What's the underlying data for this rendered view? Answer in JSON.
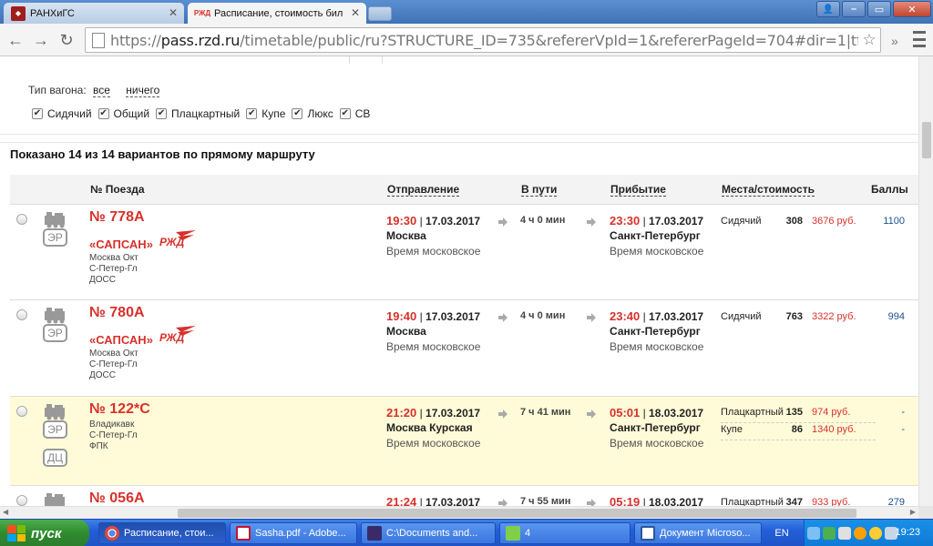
{
  "browser": {
    "tabs": [
      {
        "title": "РАНХиГС"
      },
      {
        "title": "Расписание, стоимость бил",
        "favicon_text": "РЖД"
      }
    ],
    "window_controls": {
      "user": "👤",
      "minimize": "–",
      "restore": "▭",
      "close": "✕"
    },
    "url": {
      "scheme": "https://",
      "host": "pass.rzd.ru",
      "path": "/timetable/public/ru?STRUCTURE_ID=735&refererVpId=1&refererPageId=704#dir=1|tfl=3|chec"
    },
    "menu_label": "≡",
    "ext_glyph": "»"
  },
  "filter": {
    "label": "Тип вагона:",
    "all_link": "все",
    "none_link": "ничего",
    "car_types": [
      "Сидячий",
      "Общий",
      "Плацкартный",
      "Купе",
      "Люкс",
      "СВ"
    ]
  },
  "results_summary": "Показано 14 из 14 вариантов по прямому маршруту",
  "table": {
    "headers": {
      "train": "№ Поезда",
      "departure": "Отправление",
      "duration": "В пути",
      "arrival": "Прибытие",
      "seats": "Места/стоимость",
      "points": "Баллы"
    },
    "rows": [
      {
        "train_number": "№ 778А",
        "brand": "«САПСАН»",
        "type_badges": [
          "ЭР"
        ],
        "route": [
          "Москва Окт",
          "С-Петер-Гл",
          "ДОСС"
        ],
        "dep_time": "19:30",
        "dep_date": "17.03.2017",
        "dep_station": "Москва",
        "dep_tz": "Время московское",
        "duration": "4 ч 0 мин",
        "arr_time": "23:30",
        "arr_date": "17.03.2017",
        "arr_station": "Санкт-Петербург",
        "arr_tz": "Время московское",
        "seats": [
          {
            "class": "Сидячий",
            "count": "308",
            "price": "3676 руб.",
            "points": "1100"
          }
        ]
      },
      {
        "train_number": "№ 780А",
        "brand": "«САПСАН»",
        "type_badges": [
          "ЭР"
        ],
        "route": [
          "Москва Окт",
          "С-Петер-Гл",
          "ДОСС"
        ],
        "dep_time": "19:40",
        "dep_date": "17.03.2017",
        "dep_station": "Москва",
        "dep_tz": "Время московское",
        "duration": "4 ч 0 мин",
        "arr_time": "23:40",
        "arr_date": "17.03.2017",
        "arr_station": "Санкт-Петербург",
        "arr_tz": "Время московское",
        "seats": [
          {
            "class": "Сидячий",
            "count": "763",
            "price": "3322 руб.",
            "points": "994"
          }
        ]
      },
      {
        "train_number": "№ 122*С",
        "brand": "",
        "type_badges": [
          "ЭР",
          "ДЦ"
        ],
        "route": [
          "Владикавк",
          "С-Петер-Гл",
          "ФПК"
        ],
        "dep_time": "21:20",
        "dep_date": "17.03.2017",
        "dep_station": "Москва Курская",
        "dep_tz": "Время московское",
        "duration": "7 ч 41 мин",
        "arr_time": "05:01",
        "arr_date": "18.03.2017",
        "arr_station": "Санкт-Петербург",
        "arr_tz": "Время московское",
        "seats": [
          {
            "class": "Плацкартный",
            "count": "135",
            "price": "974 руб.",
            "points": "-"
          },
          {
            "class": "Купе",
            "count": "86",
            "price": "1340 руб.",
            "points": "-"
          }
        ]
      },
      {
        "train_number": "№ 056А",
        "dep_time": "21:24",
        "dep_date": "17.03.2017",
        "duration": "7 ч 55 мин",
        "arr_time": "05:19",
        "arr_date": "18.03.2017",
        "seats": [
          {
            "class": "Плацкартный",
            "count": "347",
            "price": "933 руб.",
            "points": "279"
          }
        ]
      }
    ]
  },
  "taskbar": {
    "start_label": "пуск",
    "tasks": [
      {
        "label": "Расписание, стои..."
      },
      {
        "label": "Sasha.pdf - Adobe..."
      },
      {
        "label": "C:\\Documents and..."
      },
      {
        "label": "4"
      },
      {
        "label": "Документ Microso..."
      }
    ],
    "language": "EN",
    "clock": "19:23"
  },
  "colors": {
    "accent_red": "#d7312c",
    "highlight_row": "#fffbd8",
    "points_blue": "#1b4f8f",
    "xp_taskbar": "#245ed8",
    "xp_start": "#2f8a2f"
  }
}
